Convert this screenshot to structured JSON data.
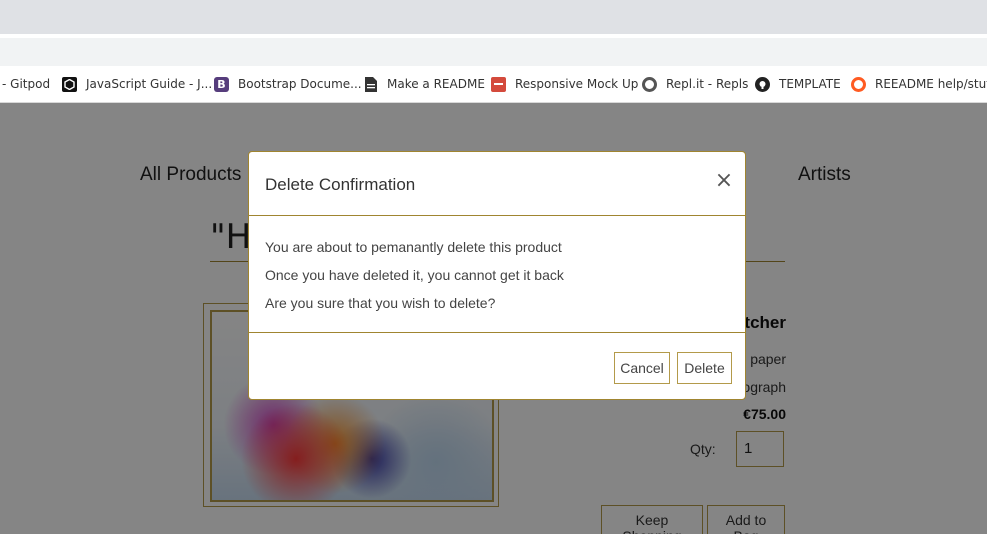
{
  "bookmarks": [
    {
      "label": "- Gitpod",
      "icon": "none"
    },
    {
      "label": "JavaScript Guide - J...",
      "icon": "codepen-icon"
    },
    {
      "label": "Bootstrap Docume...",
      "icon": "bootstrap-icon",
      "glyph": "B"
    },
    {
      "label": "Make a README",
      "icon": "document-icon"
    },
    {
      "label": "Responsive Mock Up",
      "icon": "mockup-icon"
    },
    {
      "label": "Repl.it - Repls",
      "icon": "replit-icon"
    },
    {
      "label": "TEMPLATE",
      "icon": "github-icon"
    },
    {
      "label": "REEADME help/stuff",
      "icon": "ring-icon"
    }
  ],
  "nav": {
    "all_products": "All Products",
    "artists": "Artists"
  },
  "product": {
    "title": "\"He",
    "artist_fragment": "tcher",
    "paper_fragment": "paper",
    "photo_fragment": "ograph",
    "price": "€75.00",
    "qty_label": "Qty:",
    "qty_value": "1",
    "keep_shopping": "Keep Shopping",
    "add_to_bag": "Add to Bag"
  },
  "modal": {
    "title": "Delete Confirmation",
    "close_glyph": "×",
    "lines": [
      "You are about to pemanantly delete this product",
      "Once you have deleted it, you cannot get it back",
      "Are you sure that you wish to delete?"
    ],
    "cancel_label": "Cancel",
    "delete_label": "Delete"
  },
  "colors": {
    "accent_gold": "#a08530",
    "overlay": "rgba(0,0,0,0.48)"
  }
}
